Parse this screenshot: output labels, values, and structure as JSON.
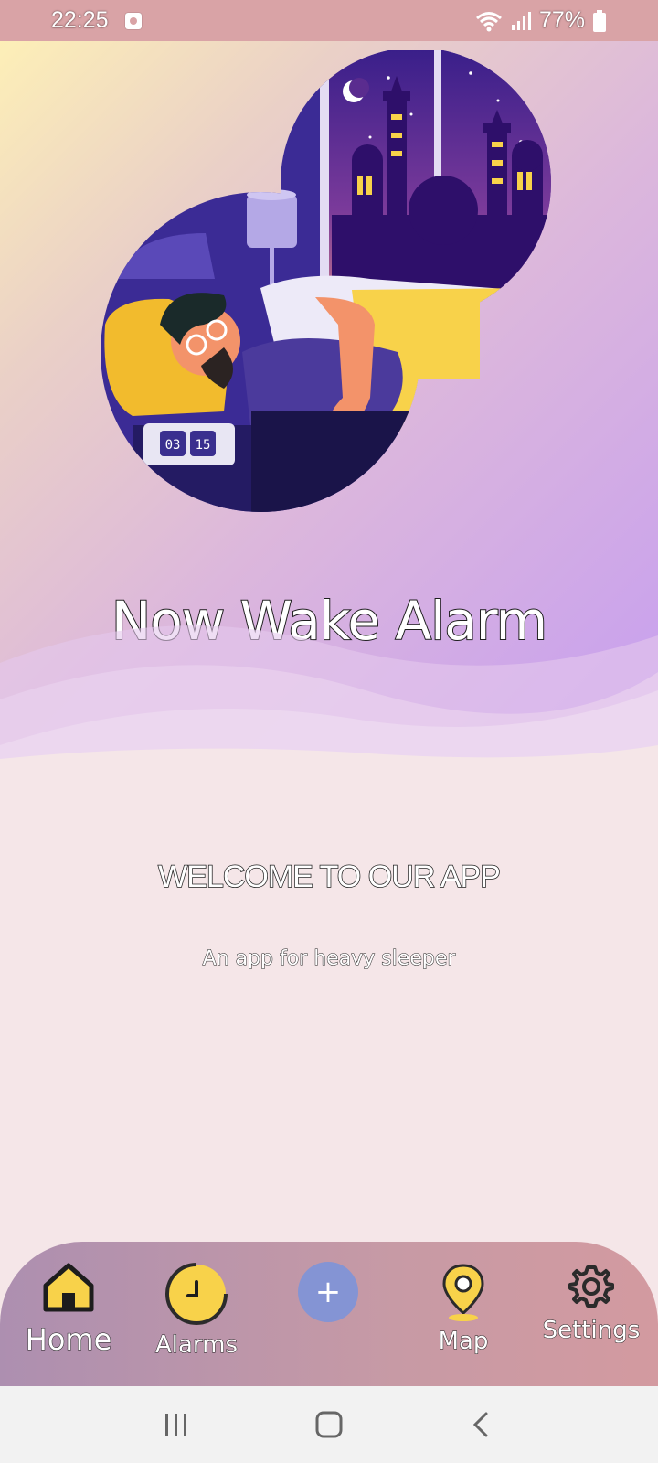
{
  "status_bar": {
    "time": "22:25",
    "battery": "77%",
    "icons": [
      "notification-icon",
      "wifi-icon",
      "signal-icon",
      "battery-icon"
    ]
  },
  "hero": {
    "title": "Now Wake Alarm",
    "clock_hours": "03",
    "clock_minutes": "15"
  },
  "content": {
    "welcome": "WELCOME TO OUR APP",
    "tagline": "An app for heavy sleeper"
  },
  "bottom_nav": {
    "home": "Home",
    "alarms": "Alarms",
    "add": "+",
    "map": "Map",
    "settings": "Settings"
  },
  "colors": {
    "status_bar": "#d9a3a6",
    "accent_yellow": "#f8d24a",
    "add_button": "#8494d4",
    "body_background": "#f5e6e8"
  }
}
